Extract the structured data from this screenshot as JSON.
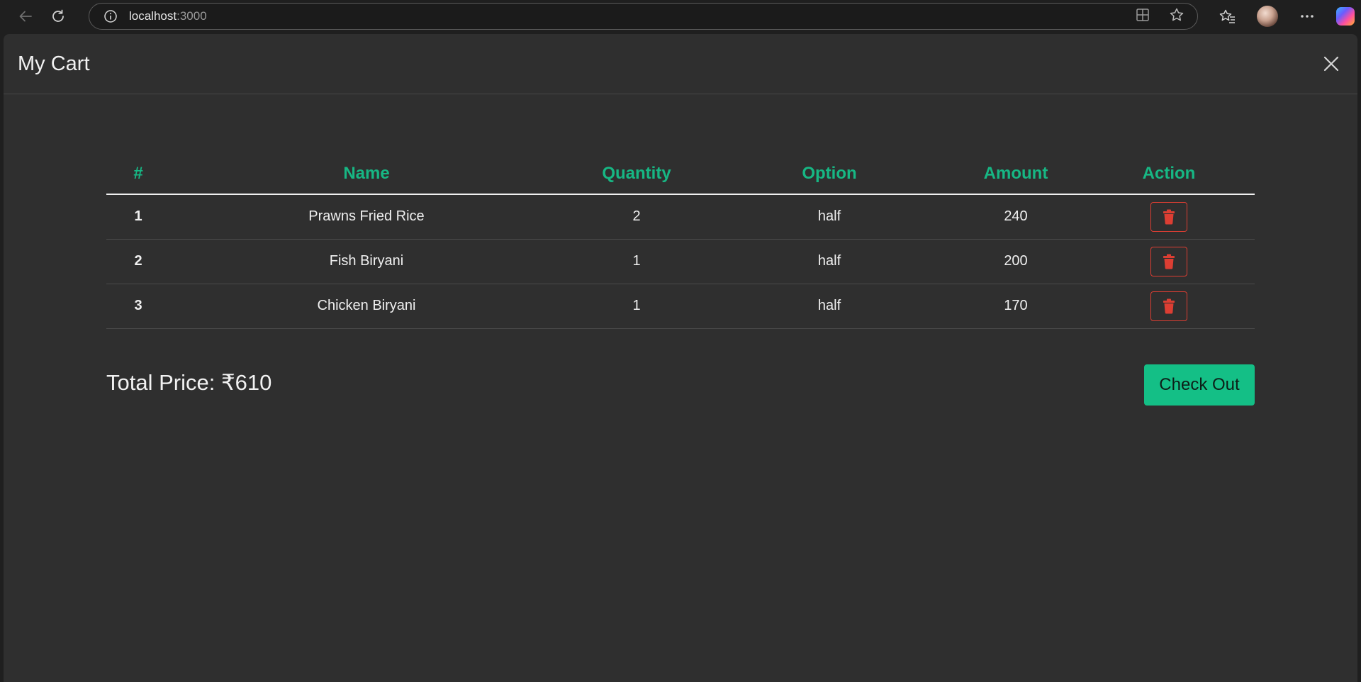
{
  "browser": {
    "url_host": "localhost",
    "url_port": ":3000"
  },
  "modal": {
    "title": "My Cart"
  },
  "table": {
    "headers": [
      "#",
      "Name",
      "Quantity",
      "Option",
      "Amount",
      "Action"
    ],
    "rows": [
      {
        "index": "1",
        "name": "Prawns Fried Rice",
        "quantity": "2",
        "option": "half",
        "amount": "240"
      },
      {
        "index": "2",
        "name": "Fish Biryani",
        "quantity": "1",
        "option": "half",
        "amount": "200"
      },
      {
        "index": "3",
        "name": "Chicken Biryani",
        "quantity": "1",
        "option": "half",
        "amount": "170"
      }
    ]
  },
  "footer": {
    "total_label": "Total Price: ₹610",
    "checkout_label": "Check Out"
  },
  "colors": {
    "accent": "#17b784",
    "checkout_bg": "#14bf86",
    "delete": "#dc3e33",
    "background": "#2f2f2f"
  }
}
